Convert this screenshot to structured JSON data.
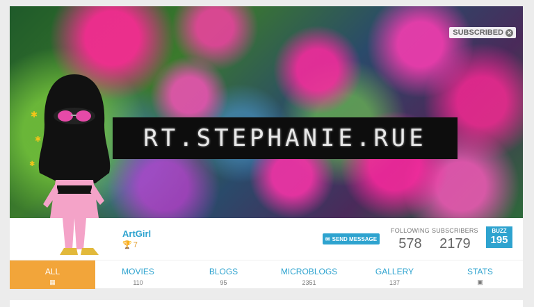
{
  "banner": {
    "title": "RT.STEPHANIE.RUE",
    "subscribed_label": "SUBSCRIBED",
    "close_icon": "close-circle-icon"
  },
  "profile": {
    "username": "ArtGirl",
    "trophy_count": "7",
    "trophy_icon": "trophy-icon",
    "send_message_label": "SEND MESSAGE",
    "send_icon": "envelope-icon",
    "following_label": "FOLLOWING",
    "following_count": "578",
    "subscribers_label": "SUBSCRIBERS",
    "subscribers_count": "2179",
    "buzz_label": "BUZZ",
    "buzz_count": "195"
  },
  "tabs": [
    {
      "label": "ALL",
      "icon": "grid-icon"
    },
    {
      "label": "MOVIES",
      "count": "110"
    },
    {
      "label": "BLOGS",
      "count": "95"
    },
    {
      "label": "MICROBLOGS",
      "count": "2351"
    },
    {
      "label": "GALLERY",
      "count": "137"
    },
    {
      "label": "STATS",
      "icon": "image-icon"
    }
  ],
  "colors": {
    "accent": "#2ea3cf",
    "active_tab": "#f2a53a",
    "trophy": "#e09a2b"
  }
}
